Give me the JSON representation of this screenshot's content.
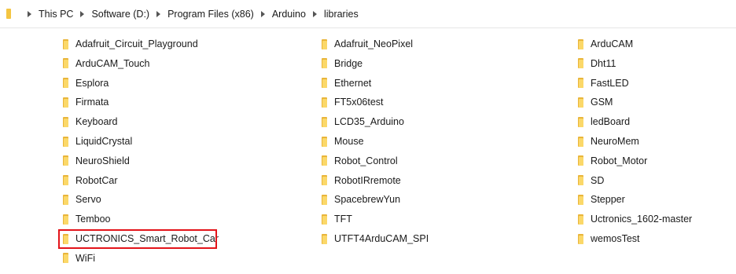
{
  "breadcrumb": {
    "items": [
      "This PC",
      "Software (D:)",
      "Program Files (x86)",
      "Arduino",
      "libraries"
    ]
  },
  "folders": {
    "col1": [
      "Adafruit_Circuit_Playground",
      "ArduCAM_Touch",
      "Esplora",
      "Firmata",
      "Keyboard",
      "LiquidCrystal",
      "NeuroShield",
      "RobotCar",
      "Servo",
      "Temboo",
      "UCTRONICS_Smart_Robot_Car",
      "WiFi"
    ],
    "col2": [
      "Adafruit_NeoPixel",
      "Bridge",
      "Ethernet",
      "FT5x06test",
      "LCD35_Arduino",
      "Mouse",
      "Robot_Control",
      "RobotIRremote",
      "SpacebrewYun",
      "TFT",
      "UTFT4ArduCAM_SPI"
    ],
    "col3": [
      "ArduCAM",
      "Dht11",
      "FastLED",
      "GSM",
      "ledBoard",
      "NeuroMem",
      "Robot_Motor",
      "SD",
      "Stepper",
      "Uctronics_1602-master",
      "wemosTest"
    ]
  },
  "colors": {
    "highlight": "#e3141a",
    "folder_front": "#fbd869",
    "folder_back": "#e9b53a"
  },
  "highlighted_folder": "UCTRONICS_Smart_Robot_Car"
}
